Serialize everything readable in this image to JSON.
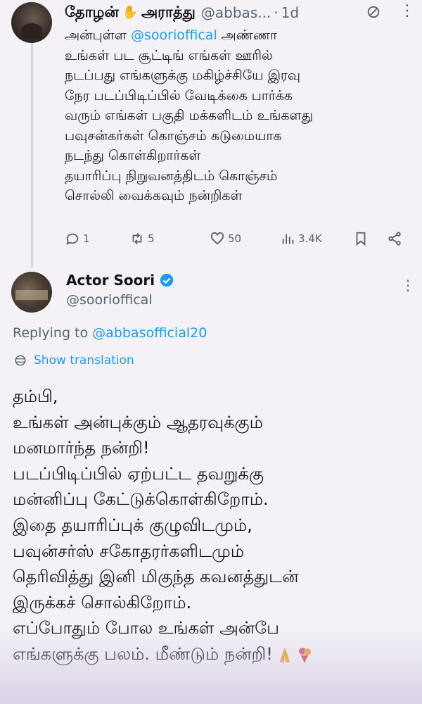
{
  "tweet": {
    "author_name": "தோழன்",
    "author_name_2": "அராத்து",
    "handle": "@abbas...",
    "time": "1d",
    "body_prefix": "அன்புள்ள",
    "mention": "@soorioffical",
    "body_lines": [
      "அண்ணா",
      "உங்கள் பட சூட்டிங் எங்கள் ஊரில்",
      "நடப்பது எங்களுக்கு மகிழ்ச்சியே இரவு",
      "நேர படப்பிடிப்பில் வேடிக்கை பார்க்க",
      "வரும் எங்கள் பகுதி மக்களிடம் உங்களது",
      "பவுசன்கர்கள் கொஞ்சம் கடுமையாக",
      "நடந்து கொள்கிறார்கள்",
      "தயாரிப்பு நிறுவனத்திடம் கொஞ்சம்",
      "சொல்லி வைக்கவும் நன்றிகள்"
    ],
    "actions": {
      "replies": "1",
      "reposts": "5",
      "likes": "50",
      "views": "3.4K"
    }
  },
  "reply": {
    "name": "Actor Soori",
    "handle": "@soorioffical",
    "replying_label": "Replying to",
    "replying_to": "@abbasofficial20",
    "translate_label": "Show translation",
    "body_lines": [
      "தம்பி,",
      "உங்கள் அன்புக்கும் ஆதரவுக்கும்",
      "மனமார்ந்த நன்றி!",
      "படப்பிடிப்பில் ஏற்பட்ட தவறுக்கு",
      "மன்னிப்பு கேட்டுக்கொள்கிறோம்.",
      "இதை தயாரிப்புக் குழுவிடமும்,",
      "பவுன்சர்ஸ் சகோதரர்களிடமும்",
      "தெரிவித்து இனி மிகுந்த கவனத்துடன்",
      "இருக்கச் சொல்கிறோம்.",
      "எப்போதும் போல உங்கள் அன்பே",
      "எங்களுக்கு பலம். மீண்டும் நன்றி!"
    ]
  },
  "icons": {
    "reply": "comment-icon",
    "repost": "repost-icon",
    "like": "heart-icon",
    "views": "views-chart-icon",
    "bookmark": "bookmark-icon",
    "share": "share-icon",
    "verified": "verified-badge-icon",
    "translate": "globe-icon",
    "more": "more-options-icon",
    "grok": "grok-icon"
  },
  "colors": {
    "link": "#1d9bf0",
    "muted": "#536471",
    "text": "#0f1419",
    "background": "#f4f2f7"
  }
}
